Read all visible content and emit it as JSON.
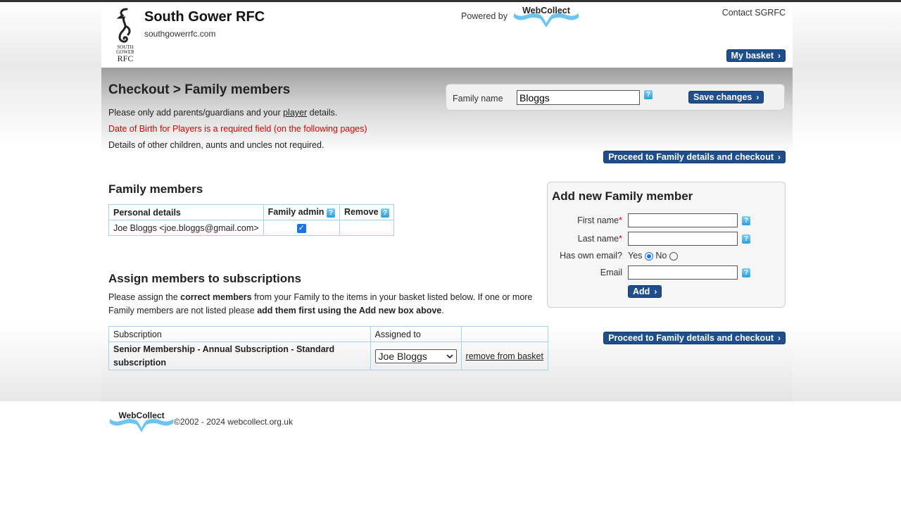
{
  "header": {
    "club_name": "South Gower RFC",
    "club_url": "southgowerrfc.com",
    "logo_text": "SOUTH GOWER RFC",
    "powered_by": "Powered by",
    "brand": "WebCollect",
    "contact": "Contact SGRFC",
    "basket": "My basket"
  },
  "checkout": {
    "title": "Checkout > Family members",
    "note1_pre": "Please only add parents/guardians and your ",
    "note1_link": "player",
    "note1_post": " details.",
    "note2": "Date of Birth for Players is a required field (on the following pages)",
    "note3": "Details of other children, aunts and uncles not required.",
    "family_name_label": "Family name",
    "family_name_value": "Bloggs",
    "save_label": "Save changes",
    "proceed_label": "Proceed to Family details and checkout"
  },
  "family_members": {
    "title": "Family members",
    "headers": [
      "Personal details",
      "Family admin",
      "Remove"
    ],
    "rows": [
      {
        "details": "Joe Bloggs <joe.bloggs@gmail.com>",
        "admin": true
      }
    ]
  },
  "assign": {
    "title": "Assign members to subscriptions",
    "text_1": "Please assign the ",
    "text_b1": "correct members",
    "text_2": " from your Family to the items in your basket listed below. If one or more Family members are not listed please ",
    "text_b2": "add them first using the Add new box above",
    "text_3": ".",
    "headers": [
      "Subscription",
      "Assigned to",
      ""
    ],
    "rows": [
      {
        "subscription": "Senior Membership - Annual Subscription - Standard subscription",
        "assigned": "Joe Bloggs",
        "remove": "remove from basket"
      }
    ]
  },
  "add_member": {
    "title": "Add new Family member",
    "first_name": "First name",
    "last_name": "Last name",
    "has_email": "Has own email?",
    "yes": "Yes",
    "no": "No",
    "email": "Email",
    "add": "Add",
    "has_email_selected": "Yes"
  },
  "footer": {
    "brand": "WebCollect",
    "copyright": "©2002 - 2024 webcollect.org.uk"
  },
  "colors": {
    "button_blue": "#1f4e8c",
    "required_red": "#e00000",
    "table_border": "#9ed4ec",
    "help_icon": "#2f9fd8"
  },
  "icons": [
    "seahorse-logo",
    "webcollect-logo",
    "chevron-right-icon",
    "help-icon",
    "checkbox-checked",
    "dropdown-arrow-icon"
  ]
}
